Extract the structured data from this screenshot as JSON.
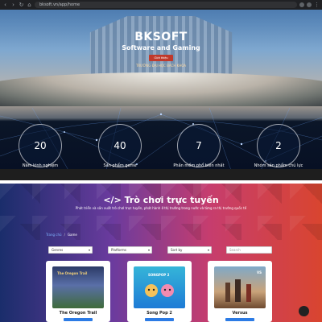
{
  "browser": {
    "url": "bksoft.vn/app/home",
    "icons": [
      "back-icon",
      "forward-icon",
      "reload-icon",
      "home-icon"
    ],
    "window_controls": [
      "–",
      "□",
      "✕"
    ]
  },
  "hero": {
    "title": "BKSOFT",
    "subtitle": "Software and Gaming",
    "button_label": "Giới thiệu",
    "caption": "TRƯỜNG ĐẠI HỌC BÁCH KHOA"
  },
  "stats": [
    {
      "value": "20",
      "label": "Năm kinh nghiệm"
    },
    {
      "value": "40",
      "label": "Sản phẩm game"
    },
    {
      "value": "7",
      "label": "Phần mềm phổ biến nhất"
    },
    {
      "value": "2",
      "label": "Nhóm sản phẩm chủ lực"
    }
  ],
  "games_page": {
    "title": "</> Trò chơi trực tuyến",
    "description": "Phát triển và sản xuất trò chơi trực tuyến, phát hành ở thị trường trong nước và từng ra thị trường quốc tế",
    "breadcrumb": {
      "home": "Trang chủ",
      "current": "Game"
    },
    "filters": {
      "genres": "Genres",
      "platforms": "Platforms",
      "sort": "Sort by",
      "search_placeholder": "Search"
    },
    "cards": [
      {
        "name": "The Oregon Trail",
        "art_text": "The Oregon Trail"
      },
      {
        "name": "Song Pop 2",
        "art_text": "SONGPOP 2"
      },
      {
        "name": "Versus",
        "art_text": "VS"
      }
    ]
  },
  "colors": {
    "accent_red": "#c0392b",
    "gradient_start": "#1a2d6b",
    "gradient_end": "#d9452f",
    "card_button": "#2c7be5"
  }
}
